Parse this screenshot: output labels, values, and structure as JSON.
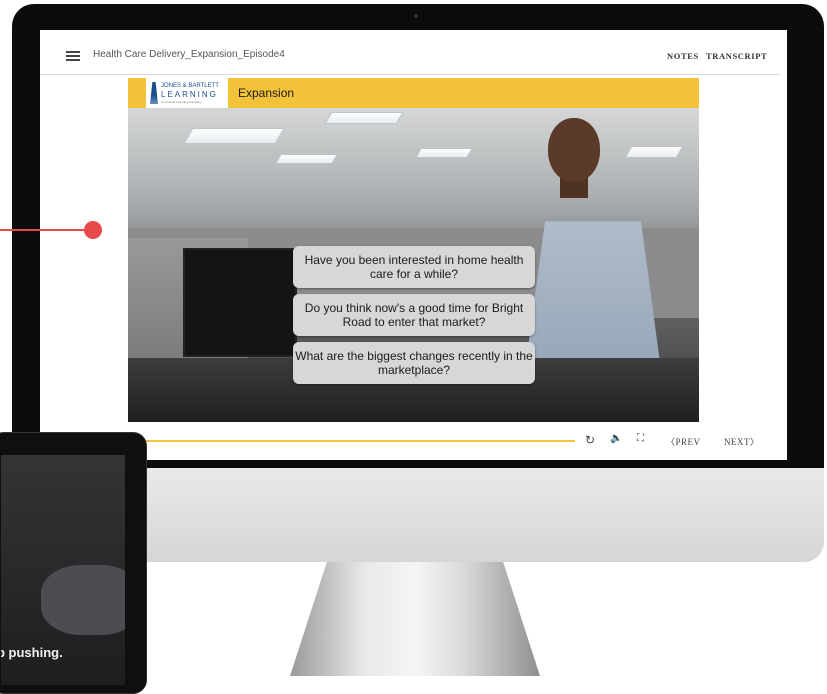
{
  "player": {
    "course_title": "Health Care Delivery_Expansion_Episode4",
    "notes_label": "NOTES",
    "transcript_label": "TRANSCRIPT"
  },
  "video": {
    "banner_title": "Expansion",
    "logo": {
      "line1": "JONES & BARTLETT",
      "line2": "LEARNING",
      "line3": "An Ascend Learning Company"
    },
    "choices": [
      "Have you been interested in home health care for a while?",
      "Do you think now's a good time for Bright Road to enter that market?",
      "What are the biggest changes recently in the marketplace?"
    ]
  },
  "controls": {
    "prev_label": "〈PREV",
    "next_label": "NEXT〉",
    "replay_icon": "↻",
    "volume_icon": "🔈",
    "fullscreen_icon": "⛶"
  },
  "laptop": {
    "caption": "p pushing."
  },
  "colors": {
    "accent_yellow": "#f3c23b",
    "callout_red": "#e84a4a"
  }
}
